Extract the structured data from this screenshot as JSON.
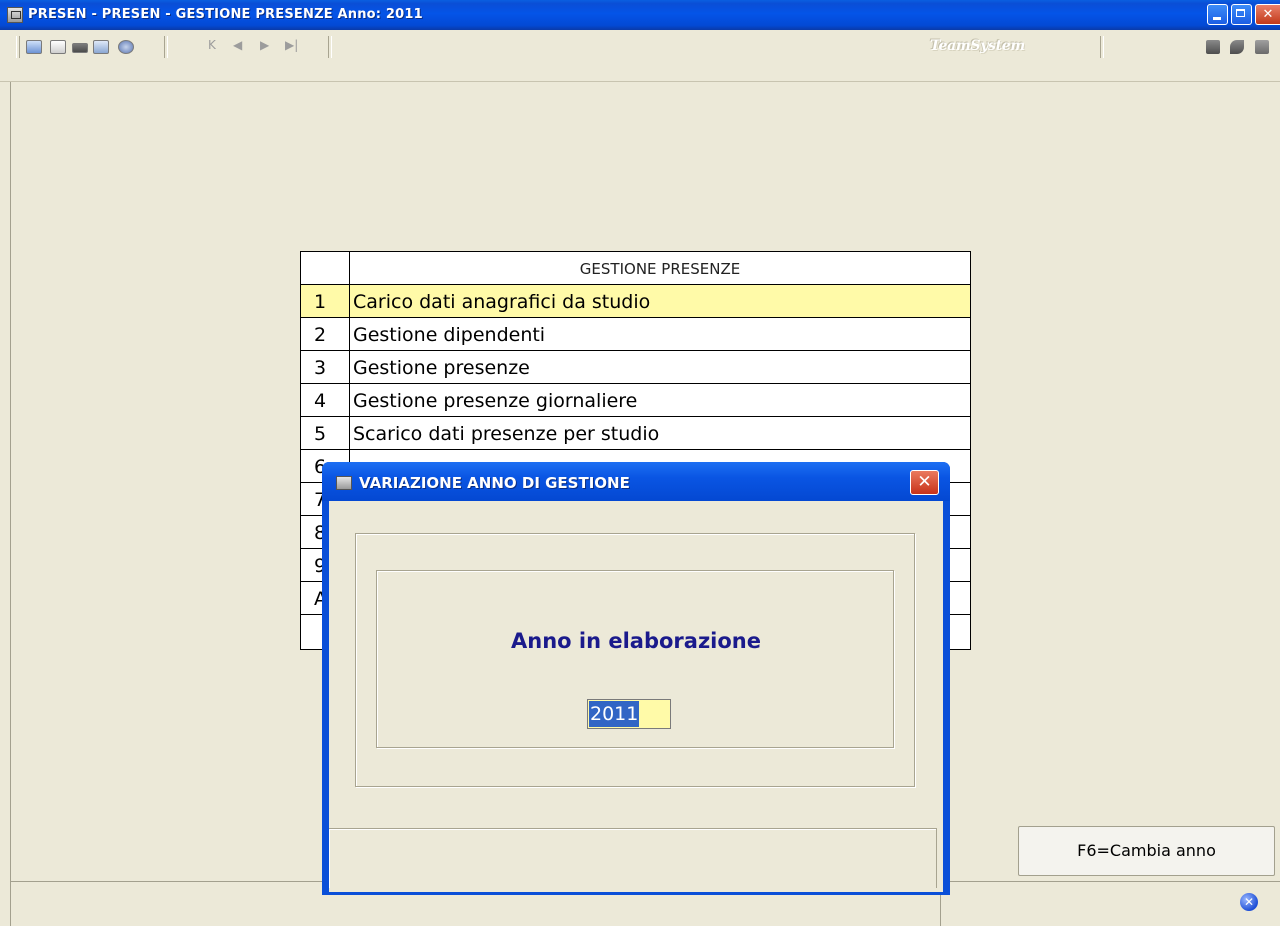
{
  "window": {
    "title": "PRESEN  - PRESEN -  GESTIONE PRESENZE  Anno: 2011",
    "controls": {
      "minimize": "minimize",
      "maximize": "maximize",
      "close": "✕"
    }
  },
  "toolbar": {
    "left_icons": [
      "new-icon",
      "print-icon",
      "folder-icon",
      "settings-icon",
      "help-icon"
    ],
    "nav": {
      "first": "K",
      "prev": "◀",
      "next": "▶",
      "last": "▶|"
    },
    "brand": "TeamSystem",
    "right_icons": [
      "export-icon",
      "arrow-icon",
      "edit-icon"
    ]
  },
  "menu": {
    "header": "GESTIONE PRESENZE",
    "items": [
      {
        "num": "1",
        "label": "Carico dati anagrafici da studio",
        "active": true
      },
      {
        "num": "2",
        "label": "Gestione dipendenti"
      },
      {
        "num": "3",
        "label": "Gestione presenze"
      },
      {
        "num": "4",
        "label": "Gestione presenze giornaliere"
      },
      {
        "num": "5",
        "label": "Scarico dati presenze per studio"
      },
      {
        "num": "6",
        "label": ""
      },
      {
        "num": "7",
        "label": ""
      },
      {
        "num": "8",
        "label": ""
      },
      {
        "num": "9",
        "label": ""
      },
      {
        "num": "A",
        "label": ""
      },
      {
        "num": "",
        "label": ""
      }
    ]
  },
  "side_button": {
    "label": "F6=Cambia anno"
  },
  "dialog": {
    "title": "VARIAZIONE ANNO DI GESTIONE",
    "close_label": "✕",
    "field_label": "Anno in elaborazione",
    "year_value": "2011"
  },
  "colors": {
    "titlebar": "#0454e8",
    "selected_row": "#fffaa8",
    "label_text": "#1a1a8c",
    "selection": "#3165c5"
  }
}
